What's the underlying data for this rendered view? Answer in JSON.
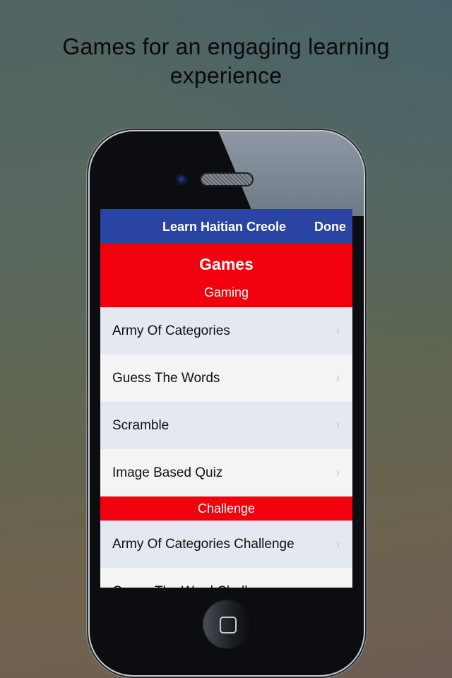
{
  "headline": {
    "line1": "Games for an engaging learning",
    "line2": "experience"
  },
  "device": {
    "icons": [
      "camera-icon",
      "speaker-icon",
      "home-button-icon"
    ]
  },
  "app": {
    "navbar": {
      "title": "Learn Haitian Creole",
      "done_label": "Done",
      "color": "#2944a3"
    },
    "page_title": "Games",
    "accent_color": "#f2000d",
    "sections": [
      {
        "label": "Gaming",
        "items": [
          {
            "label": "Army Of Categories"
          },
          {
            "label": "Guess The Words"
          },
          {
            "label": "Scramble"
          },
          {
            "label": "Image Based Quiz"
          }
        ]
      },
      {
        "label": "Challenge",
        "items": [
          {
            "label": "Army Of Categories Challenge"
          },
          {
            "label": "Guess The Word Challenge"
          }
        ]
      }
    ],
    "chevron_glyph": "›"
  }
}
